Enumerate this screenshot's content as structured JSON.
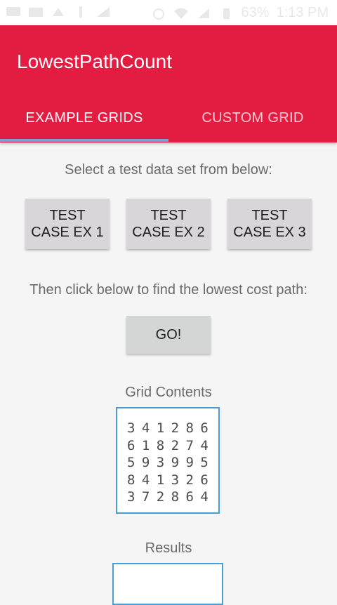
{
  "status_bar": {
    "battery_percent": "63%",
    "time": "1:13 PM",
    "icons": [
      "message-icon",
      "mail-icon",
      "usb-settings-icon",
      "usb-icon",
      "no-signal-icon",
      "alarm-icon",
      "wifi-icon",
      "signal-icon",
      "battery-icon"
    ]
  },
  "app": {
    "title": "LowestPathCount",
    "brand_color": "#e31c42"
  },
  "tabs": [
    {
      "label": "EXAMPLE GRIDS",
      "selected": true
    },
    {
      "label": "CUSTOM GRID",
      "selected": false
    }
  ],
  "main": {
    "select_prompt": "Select a test data set from below:",
    "test_buttons": [
      {
        "label": "TEST\nCASE EX 1"
      },
      {
        "label": "TEST\nCASE EX 2"
      },
      {
        "label": "TEST\nCASE EX 3"
      }
    ],
    "go_prompt": "Then click below to find the lowest cost path:",
    "go_label": "GO!",
    "grid_title": "Grid Contents",
    "grid_rows": [
      "3 4 1 2 8 6",
      "6 1 8 2 7 4",
      "5 9 3 9 9 5",
      "8 4 1 3 2 6",
      "3 7 2 8 6 4"
    ],
    "results_title": "Results"
  }
}
